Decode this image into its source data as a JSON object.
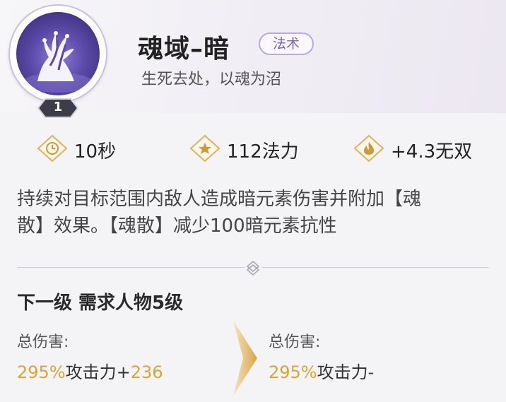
{
  "skill": {
    "name": "魂域–暗",
    "type_tag": "法术",
    "subtitle": "生死去处，以魂为沼",
    "level": "1"
  },
  "stats": [
    {
      "icon": "clock-icon",
      "value": "10秒"
    },
    {
      "icon": "star-icon",
      "value": "112法力"
    },
    {
      "icon": "flame-icon",
      "value": "+4.3无双"
    }
  ],
  "description": {
    "line1": "持续对目标范围内敌人造成暗元素伤害并附加【魂",
    "line2": "散】效果。【魂散】减少100暗元素抗性"
  },
  "next_level": {
    "title": "下一级 需求人物5级",
    "current": {
      "label": "总伤害:",
      "pct": "295%",
      "text": "攻击力+",
      "bonus": "236"
    },
    "next": {
      "label": "总伤害:",
      "pct": "295%",
      "text": "攻击力-"
    }
  },
  "colors": {
    "accent_gold": "#d9a53b",
    "tag_purple": "#7a63b8"
  }
}
